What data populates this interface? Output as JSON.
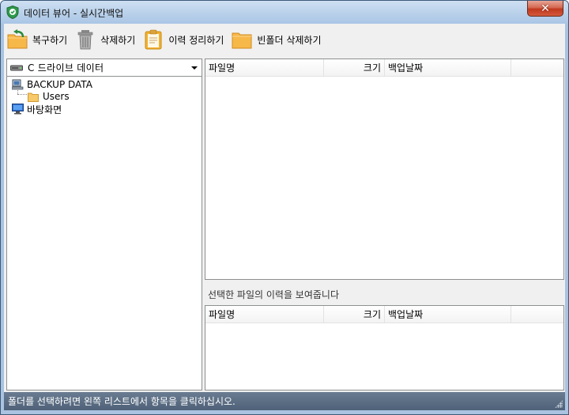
{
  "window": {
    "title": "데이터 뷰어 - 실시간백업",
    "close_label": "✕"
  },
  "toolbar": {
    "restore_label": "복구하기",
    "delete_label": "삭제하기",
    "clean_history_label": "이력 정리하기",
    "delete_empty_folders_label": "빈폴더 삭제하기"
  },
  "drive": {
    "selected": "C 드라이브 데이터"
  },
  "tree": {
    "items": [
      {
        "label": "BACKUP DATA",
        "icon": "computer-icon"
      },
      {
        "label": "Users",
        "icon": "folder-icon"
      },
      {
        "label": "바탕화면",
        "icon": "monitor-icon"
      }
    ]
  },
  "file_list": {
    "columns": {
      "name": "파일명",
      "size": "크기",
      "date": "백업날짜"
    }
  },
  "history": {
    "label": "선택한 파일의 이력을 보여줍니다",
    "columns": {
      "name": "파일명",
      "size": "크기",
      "date": "백업날짜"
    }
  },
  "status": {
    "text": "폴더를 선택하려면 왼쪽 리스트에서 항목을 클릭하십시오."
  },
  "colors": {
    "titlebar": "#b7cfe9",
    "statusbar": "#5a6d84",
    "folder": "#f7b84a",
    "close": "#c0391f"
  }
}
